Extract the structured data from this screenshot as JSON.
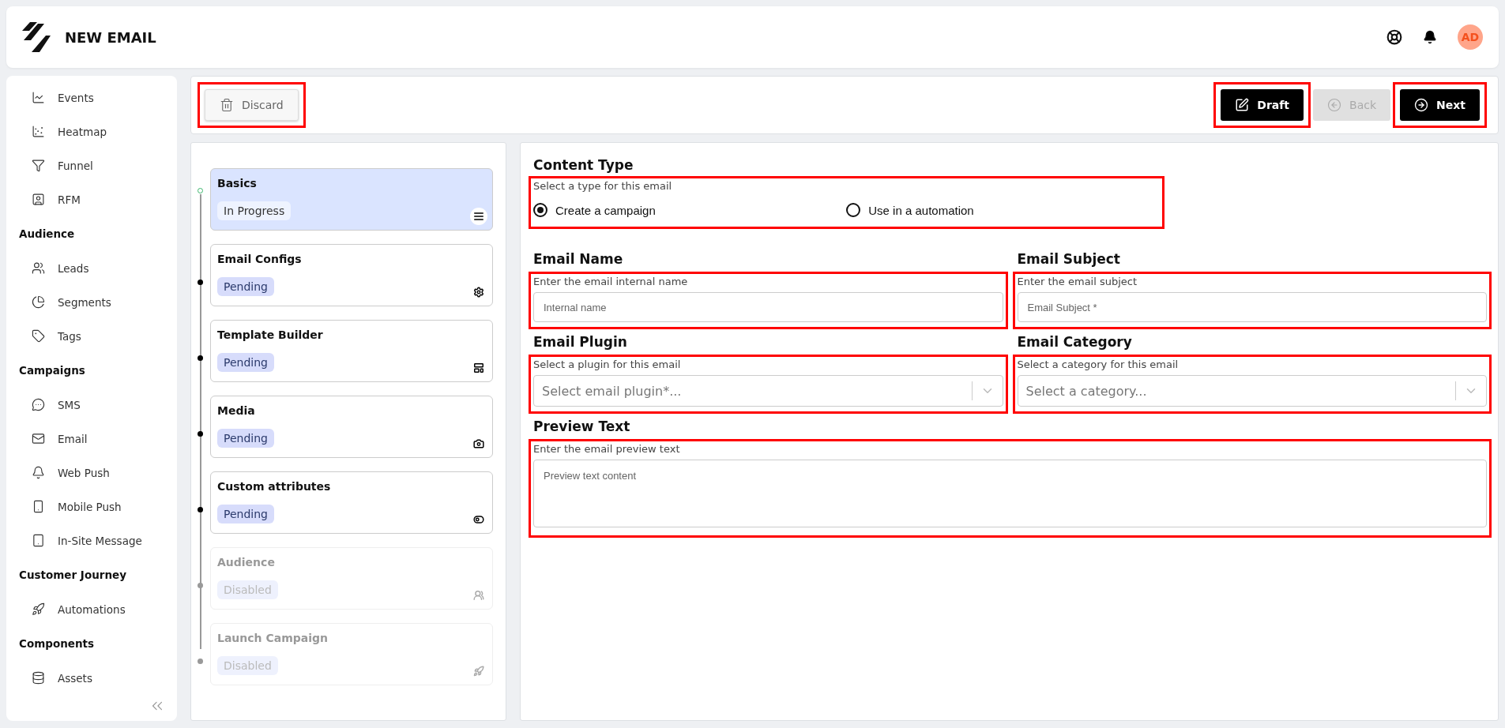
{
  "header": {
    "title": "NEW EMAIL",
    "avatar": "AD"
  },
  "sidebar": {
    "groups": [
      {
        "items": [
          {
            "label": "Events"
          },
          {
            "label": "Heatmap"
          },
          {
            "label": "Funnel"
          },
          {
            "label": "RFM"
          }
        ]
      },
      {
        "title": "Audience",
        "items": [
          {
            "label": "Leads"
          },
          {
            "label": "Segments"
          },
          {
            "label": "Tags"
          }
        ]
      },
      {
        "title": "Campaigns",
        "items": [
          {
            "label": "SMS"
          },
          {
            "label": "Email"
          },
          {
            "label": "Web Push"
          },
          {
            "label": "Mobile Push"
          },
          {
            "label": "In-Site Message"
          }
        ]
      },
      {
        "title": "Customer Journey",
        "items": [
          {
            "label": "Automations"
          }
        ]
      },
      {
        "title": "Components",
        "items": [
          {
            "label": "Assets"
          }
        ]
      }
    ]
  },
  "toolbar": {
    "discard": {
      "label": "Discard",
      "highlighted": true
    },
    "draft": {
      "label": "Draft",
      "highlighted": true
    },
    "back": {
      "label": "Back",
      "disabled": true,
      "highlighted": false
    },
    "next": {
      "label": "Next",
      "highlighted": true
    }
  },
  "steps": [
    {
      "title": "Basics",
      "status": "In Progress",
      "kind": "progress",
      "selected": true
    },
    {
      "title": "Email Configs",
      "status": "Pending",
      "kind": "pending",
      "selected": false
    },
    {
      "title": "Template Builder",
      "status": "Pending",
      "kind": "pending",
      "selected": false
    },
    {
      "title": "Media",
      "status": "Pending",
      "kind": "pending",
      "selected": false
    },
    {
      "title": "Custom attributes",
      "status": "Pending",
      "kind": "pending",
      "selected": false
    },
    {
      "title": "Audience",
      "status": "Disabled",
      "kind": "disabled",
      "selected": false
    },
    {
      "title": "Launch Campaign",
      "status": "Disabled",
      "kind": "disabled",
      "selected": false
    }
  ],
  "content_type": {
    "title": "Content Type",
    "hint": "Select a type for this email",
    "highlighted": true,
    "options": [
      {
        "label": "Create a campaign",
        "selected": true
      },
      {
        "label": "Use in a automation",
        "selected": false
      }
    ]
  },
  "fields": [
    {
      "title": "Email Name",
      "hint": "Enter the email internal name",
      "kind": "input",
      "placeholder": "Internal name",
      "highlighted": true
    },
    {
      "title": "Email Subject",
      "hint": "Enter the email subject",
      "kind": "input",
      "placeholder": "Email Subject *",
      "highlighted": true
    },
    {
      "title": "Email Plugin",
      "hint": "Select a plugin for this email",
      "kind": "select",
      "placeholder": "Select email plugin*...",
      "highlighted": true
    },
    {
      "title": "Email Category",
      "hint": "Select a category for this email",
      "kind": "select",
      "placeholder": "Select a category...",
      "highlighted": true
    },
    {
      "title": "Preview Text",
      "hint": "Enter the email preview text",
      "kind": "textarea",
      "placeholder": "Preview text content",
      "highlighted": true
    }
  ]
}
